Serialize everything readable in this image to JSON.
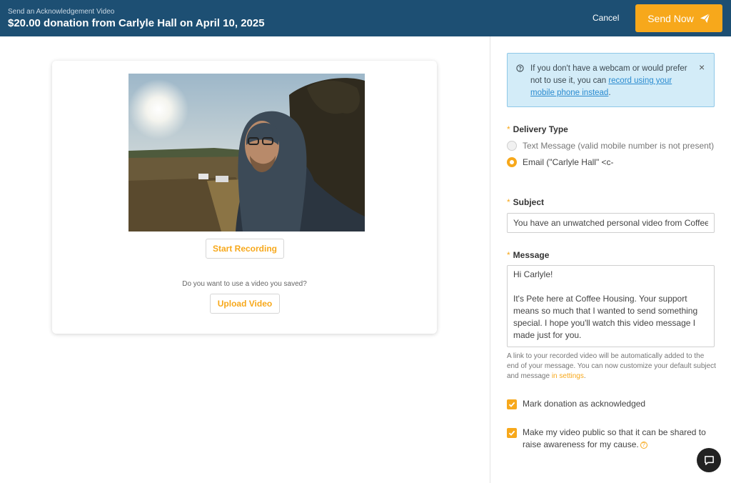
{
  "header": {
    "kicker": "Send an Acknowledgement Video",
    "title": "$20.00 donation from Carlyle Hall on April 10, 2025",
    "cancel_label": "Cancel",
    "send_label": "Send Now"
  },
  "recorder": {
    "start_label": "Start Recording",
    "saved_question": "Do you want to use a video you saved?",
    "upload_label": "Upload Video"
  },
  "info": {
    "text_before": "If you don't have a webcam or would prefer not to use it, you can ",
    "link_text": "record using your mobile phone instead",
    "text_after": ".",
    "close_glyph": "×"
  },
  "delivery": {
    "label": "Delivery Type",
    "required_mark": "*",
    "options": [
      {
        "label": "Text Message (valid mobile number is not present)",
        "selected": false,
        "disabled": true
      },
      {
        "label": "Email (\"Carlyle Hall\" <c-",
        "selected": true,
        "disabled": false
      }
    ]
  },
  "subject": {
    "label": "Subject",
    "required_mark": "*",
    "value": "You have an unwatched personal video from Coffee Housing"
  },
  "message": {
    "label": "Message",
    "required_mark": "*",
    "greeting": "Hi Carlyle!",
    "body": "It's Pete here at Coffee Housing. Your support means so much that I wanted to send something special. I hope you'll watch this video message I made just for you."
  },
  "helper": {
    "text": "A link to your recorded video will be automatically added to the end of your message. You can now customize your default subject and message ",
    "link_text": "in settings",
    "after": "."
  },
  "options": {
    "acknowledged_label": "Mark donation as acknowledged",
    "acknowledged_checked": true,
    "public_label": "Make my video public so that it can be shared to raise awareness for my cause.",
    "public_checked": true
  },
  "colors": {
    "header_bg": "#1d4f73",
    "accent": "#f7a81b",
    "info_bg": "#d3ecf8",
    "link": "#2a8bd0"
  },
  "icons": {
    "send": "paper-plane-icon",
    "info": "question-circle-icon",
    "close": "close-icon",
    "help": "question-circle-icon",
    "chat": "chat-bubble-icon",
    "check": "checkmark-icon"
  }
}
